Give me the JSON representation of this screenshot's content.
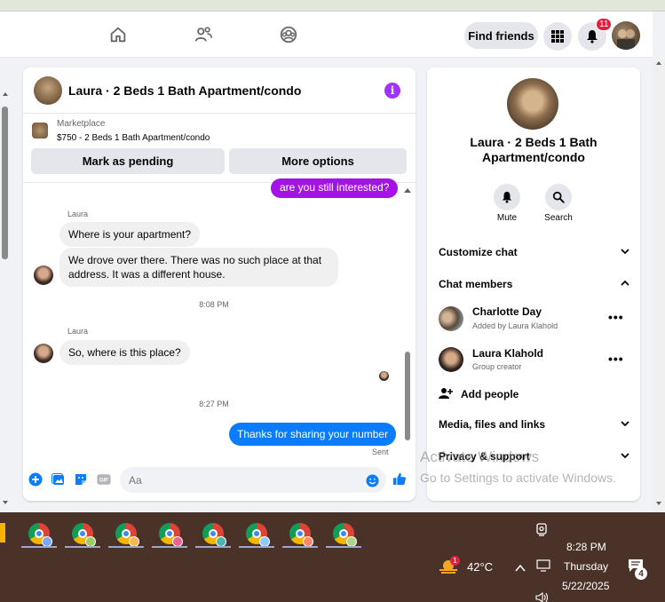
{
  "navbar": {
    "find_friends_label": "Find friends",
    "notification_count": "11"
  },
  "chat": {
    "title": "Laura · 2 Beds 1 Bath Apartment/condo",
    "marketplace_label": "Marketplace",
    "listing": "$750 - 2 Beds 1 Bath Apartment/condo",
    "mark_pending_label": "Mark as pending",
    "more_options_label": "More options",
    "messages": {
      "outgoing_1": "are you still interested?",
      "sender_1": "Laura",
      "incoming_1": "Where is your apartment?",
      "incoming_2": "We drove over there. There was no such place at that address. It was a different house.",
      "time_1": "8:08 PM",
      "sender_2": "Laura",
      "incoming_3": "So, where is this place?",
      "time_2": "8:27 PM",
      "outgoing_2": "Thanks for sharing your number",
      "status": "Sent"
    },
    "composer_placeholder": "Aa"
  },
  "info_panel": {
    "name": "Laura · 2 Beds 1 Bath Apartment/condo",
    "mute_label": "Mute",
    "search_label": "Search",
    "customize_chat": "Customize chat",
    "chat_members": "Chat members",
    "members": [
      {
        "name": "Charlotte Day",
        "sub": "Added by Laura Klahold"
      },
      {
        "name": "Laura Klahold",
        "sub": "Group creator"
      }
    ],
    "add_people": "Add people",
    "media_files": "Media, files and links",
    "privacy_support": "Privacy & support"
  },
  "watermark": {
    "line1": "Activate Windows",
    "line2": "Go to Settings to activate Windows."
  },
  "taskbar": {
    "time": "8:28 PM",
    "day": "Thursday",
    "date": "5/22/2025",
    "temperature": "42°C",
    "weather_badge": "1",
    "notification_count": "4"
  },
  "colors": {
    "messenger_blue": "#0a7cff",
    "messenger_purple": "#a314e4",
    "taskbar_bg": "#4a3228"
  }
}
